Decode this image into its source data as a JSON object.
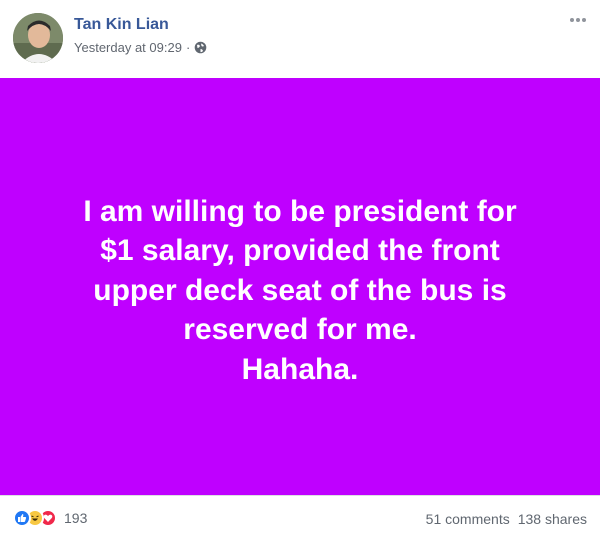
{
  "post": {
    "author": "Tan Kin Lian",
    "timestamp": "Yesterday at 09:29",
    "separator": "·",
    "privacy_icon": "globe-icon",
    "more_icon": "more-options-icon",
    "background_color": "#bf00ff",
    "text_lines": [
      "I am willing to be president for",
      "$1 salary, provided the front",
      "upper deck seat of the bus is",
      "reserved for me.",
      "Hahaha."
    ]
  },
  "footer": {
    "reaction_icons": [
      "like-icon",
      "haha-icon",
      "love-icon"
    ],
    "reaction_count": "193",
    "comments": "51 comments",
    "shares": "138 shares"
  }
}
